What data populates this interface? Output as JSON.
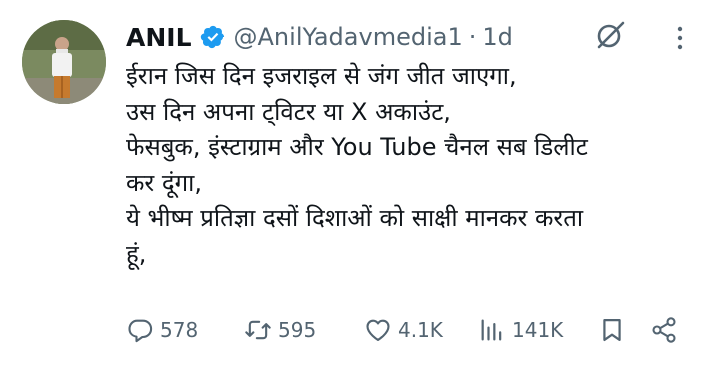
{
  "author": {
    "name": "ANIL",
    "handle": "@AnilYadavmedia1",
    "separator": "·",
    "time": "1d"
  },
  "tweet": {
    "lines": [
      "ईरान जिस दिन इजराइल से जंग जीत जाएगा,",
      "उस दिन अपना ट्विटर या X अकाउंट,",
      "फेसबुक, इंस्टाग्राम और You Tube चैनल सब डिलीट",
      "कर दूंगा,",
      "ये भीष्म प्रतिज्ञा दसों दिशाओं को साक्षी मानकर करता",
      "हूं,"
    ]
  },
  "actions": {
    "replies": "578",
    "reposts": "595",
    "likes": "4.1K",
    "views": "141K"
  },
  "colors": {
    "text": "#0f1419",
    "muted": "#536471",
    "verified": "#1d9bf0"
  },
  "icons": [
    "verified-badge-icon",
    "grok-icon",
    "more-options-icon",
    "reply-icon",
    "repost-icon",
    "like-icon",
    "views-icon",
    "bookmark-icon",
    "share-icon"
  ]
}
